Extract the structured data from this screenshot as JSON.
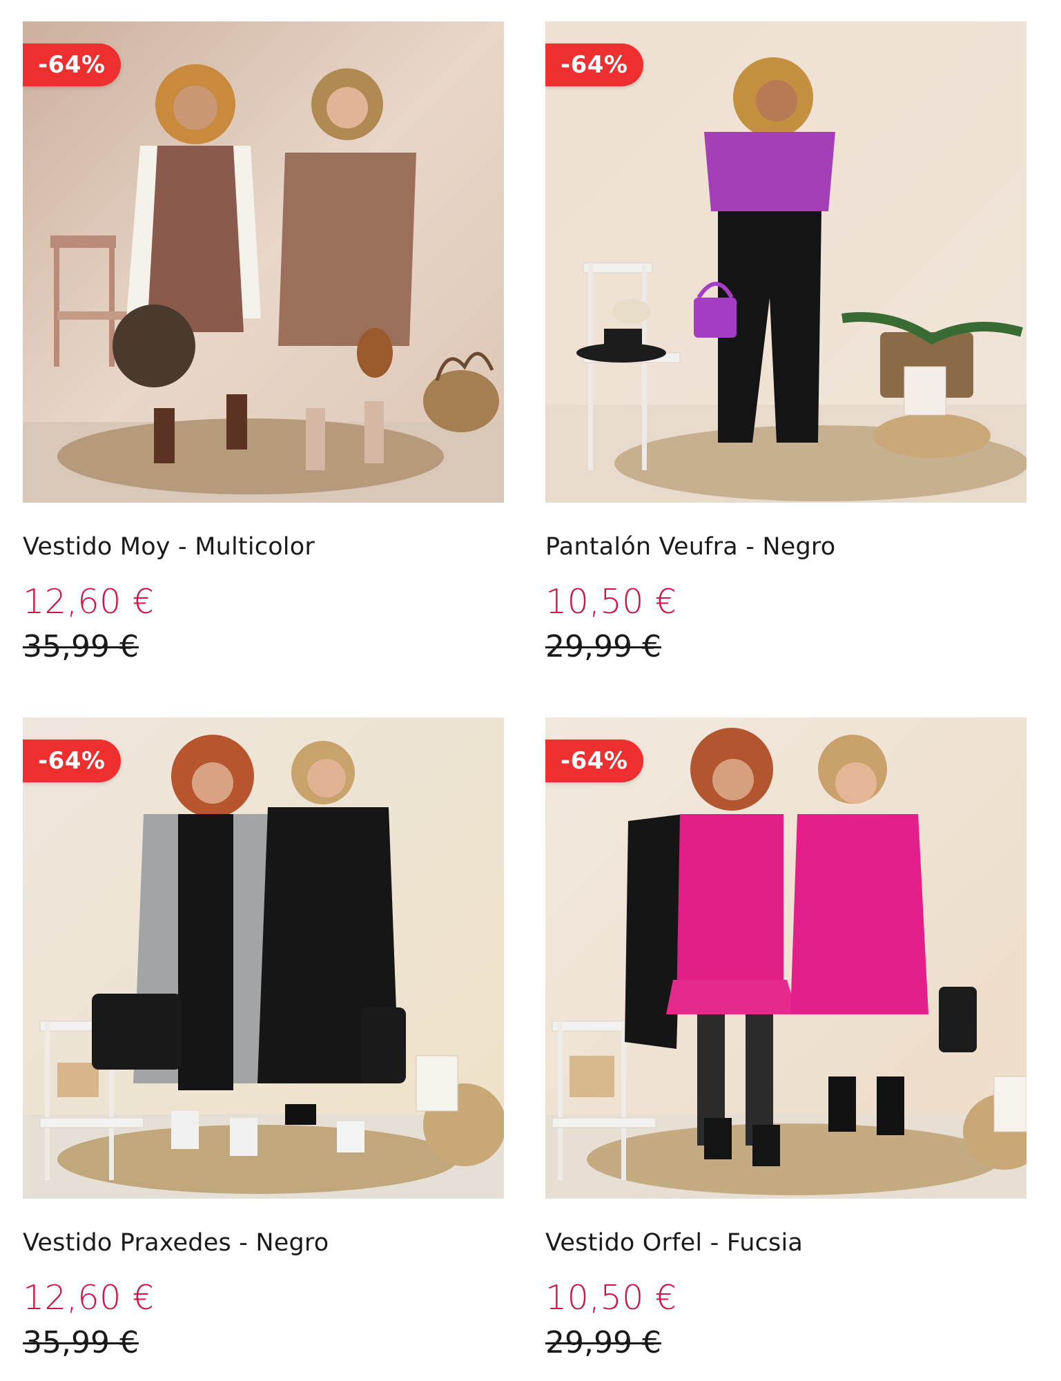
{
  "products": [
    {
      "name": "Vestido Moy - Multicolor",
      "price": "12,60 €",
      "old_price": "35,99 €",
      "discount": "-64%",
      "image_icon": "product-photo-two-women-floral-dress"
    },
    {
      "name": "Pantalón Veufra - Negro",
      "price": "10,50 €",
      "old_price": "29,99 €",
      "discount": "-64%",
      "image_icon": "product-photo-woman-purple-top-black-trousers"
    },
    {
      "name": "Vestido Praxedes - Negro",
      "price": "12,60 €",
      "old_price": "35,99 €",
      "discount": "-64%",
      "image_icon": "product-photo-two-women-black-dress-grey-coat"
    },
    {
      "name": "Vestido Orfel - Fucsia",
      "price": "10,50 €",
      "old_price": "29,99 €",
      "discount": "-64%",
      "image_icon": "product-photo-two-women-fuchsia-dress"
    }
  ],
  "colors": {
    "badge": "#ee2f2f",
    "sale_price": "#d31245",
    "text": "#1a1a1a"
  }
}
